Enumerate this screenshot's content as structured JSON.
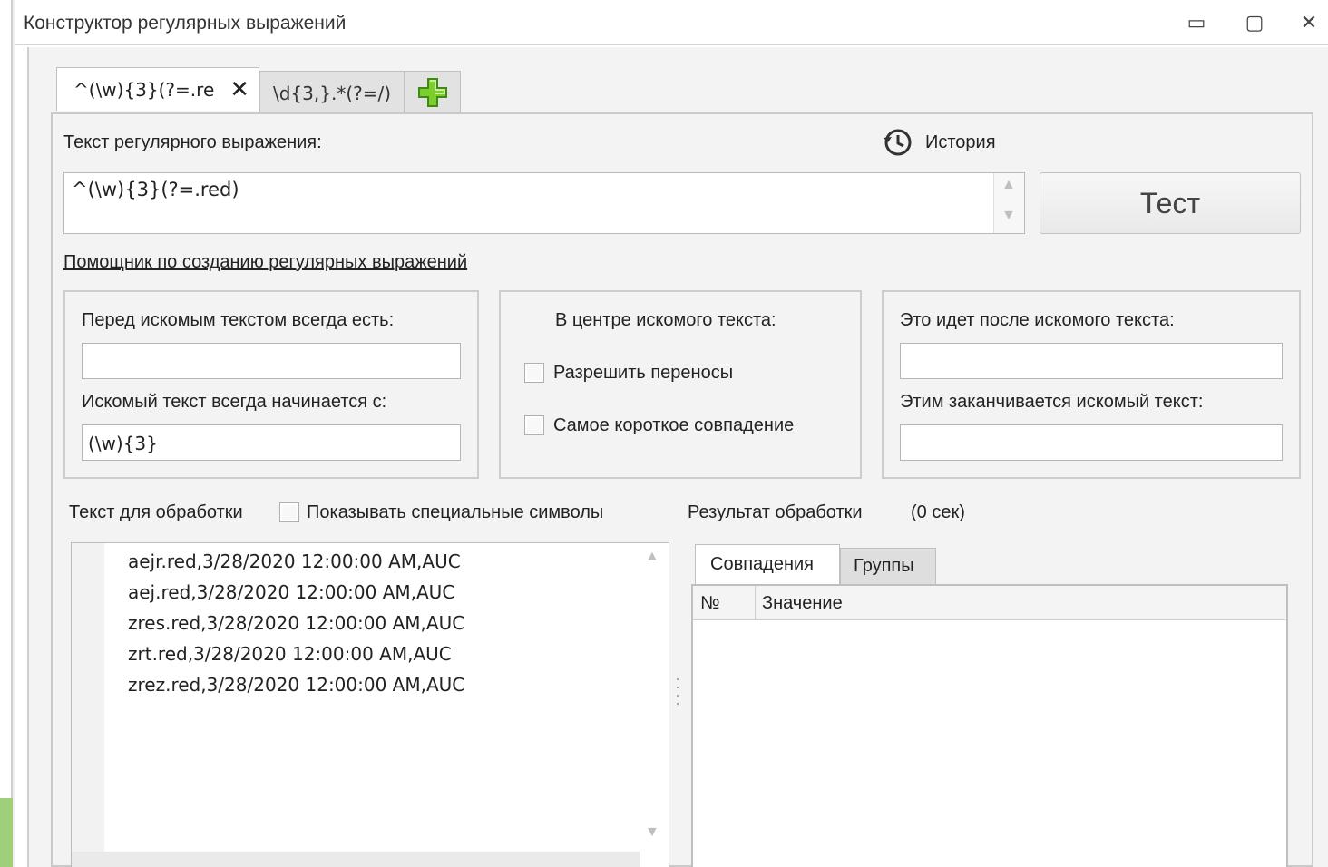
{
  "window": {
    "title": "Конструктор регулярных выражений",
    "controls": {
      "minimize": "▭",
      "maximize": "▢",
      "close": "✕"
    }
  },
  "tabs": [
    {
      "label": "^(\\w){3}(?=.re",
      "active": true,
      "close": "✕"
    },
    {
      "label": "\\d{3,}.*(?=/)",
      "active": false
    }
  ],
  "add_tab_icon": "plus-icon",
  "regex": {
    "label": "Текст регулярного выражения:",
    "value": "^(\\w){3}(?=.red)",
    "history_label": "История",
    "test_button": "Тест"
  },
  "helper_link": "Помощник по созданию регулярных выражений",
  "before_group": {
    "before_label": "Перед искомым текстом всегда есть:",
    "before_value": "",
    "starts_label": "Искомый текст всегда начинается с:",
    "starts_value": "(\\w){3}"
  },
  "center_group": {
    "title": "В центре искомого текста:",
    "allow_linebreaks": "Разрешить переносы",
    "shortest_match": "Самое короткое совпадение"
  },
  "after_group": {
    "after_label": "Это идет после искомого текста:",
    "after_value": "",
    "ends_label": "Этим заканчивается искомый текст:",
    "ends_value": ""
  },
  "input_text": {
    "label": "Текст для обработки",
    "show_special": "Показывать специальные символы",
    "lines": [
      "aejr.red,3/28/2020 12:00:00 AM,AUC",
      "aej.red,3/28/2020 12:00:00 AM,AUC",
      "zres.red,3/28/2020 12:00:00 AM,AUC",
      "zrt.red,3/28/2020 12:00:00 AM,AUC",
      "zrez.red,3/28/2020 12:00:00 AM,AUC"
    ]
  },
  "result": {
    "label": "Результат обработки",
    "time": "(0 сек)",
    "tabs": [
      "Совпадения",
      "Группы"
    ],
    "columns": [
      "№",
      "Значение"
    ]
  }
}
